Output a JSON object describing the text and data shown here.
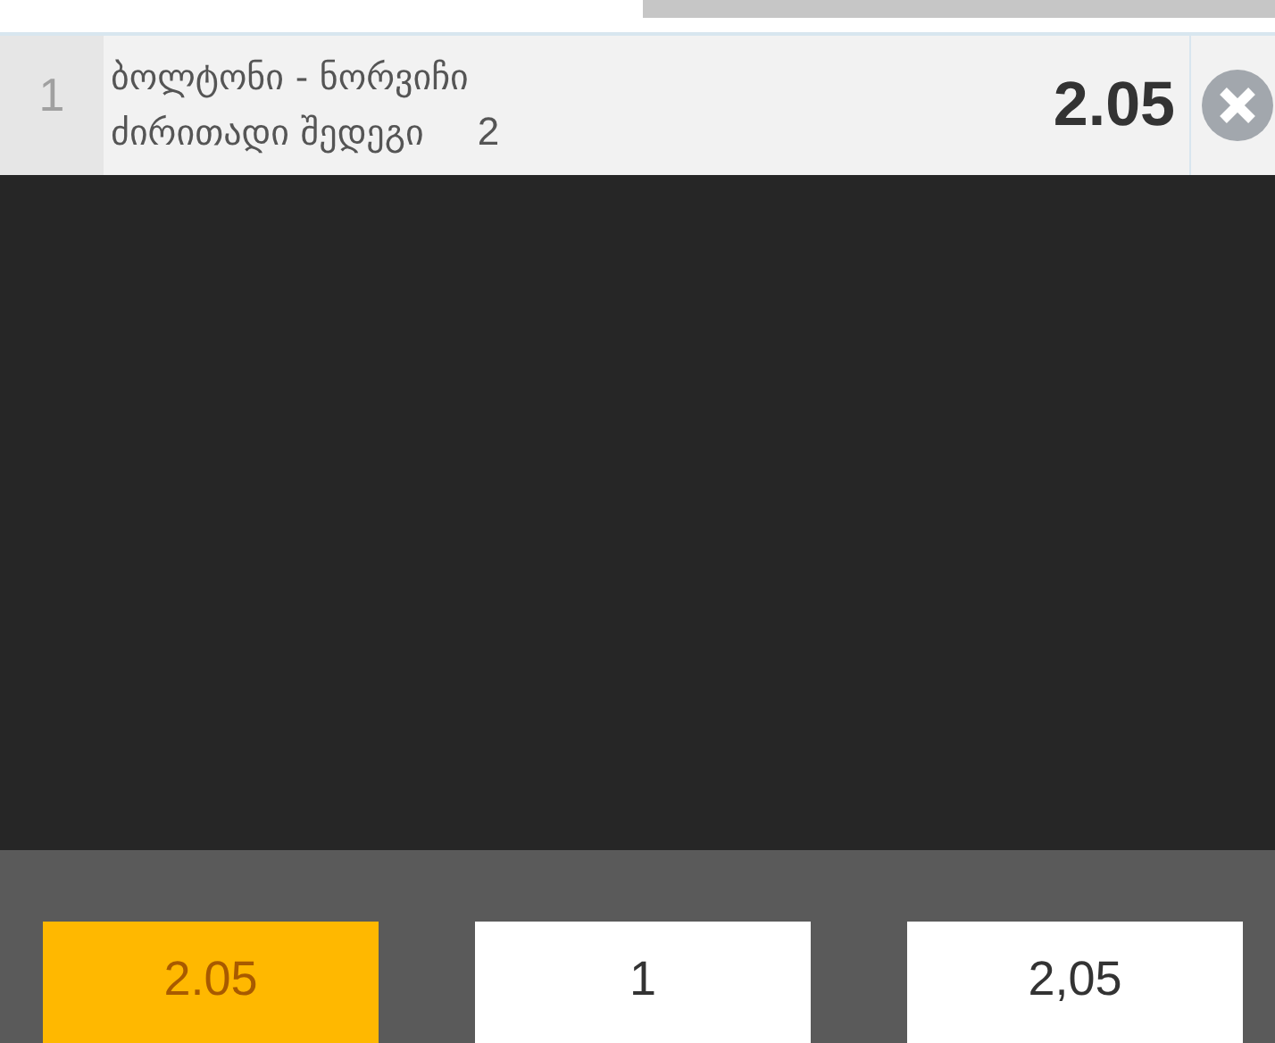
{
  "bet": {
    "index": "1",
    "match": "ბოლტონი - ნორვიჩი",
    "market": "ძირითადი შედეგი",
    "pick": "2",
    "odds": "2.05"
  },
  "options": [
    {
      "label": "2.05",
      "selected": true
    },
    {
      "label": "1",
      "selected": false
    },
    {
      "label": "2,05",
      "selected": false
    }
  ]
}
